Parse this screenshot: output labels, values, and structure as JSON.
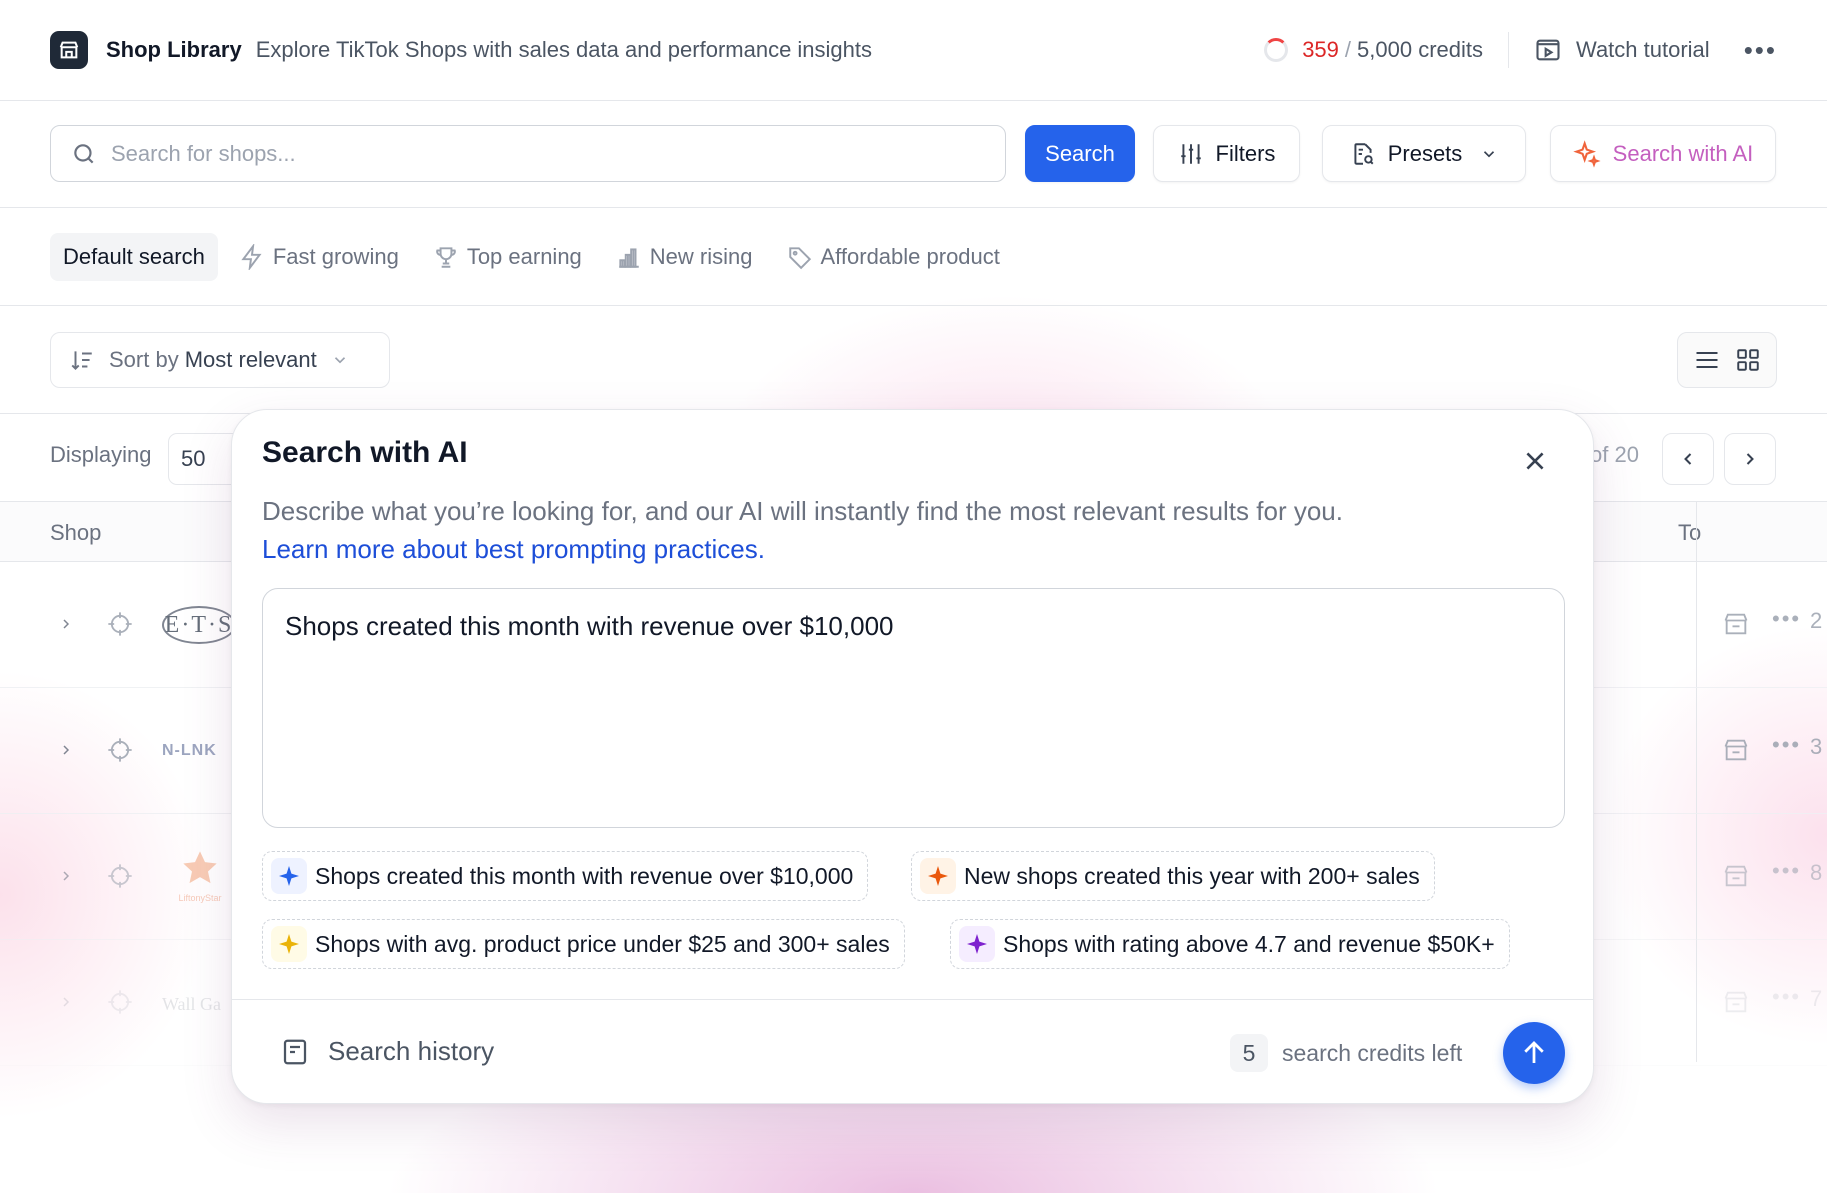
{
  "header": {
    "title": "Shop Library",
    "subtitle": "Explore TikTok Shops with sales data and performance insights",
    "credits_used": "359",
    "credits_total": "5,000 credits",
    "credits_sep": "/",
    "watch_tutorial": "Watch tutorial",
    "more": "•••"
  },
  "search": {
    "placeholder": "Search for shops...",
    "search_button": "Search",
    "filters_button": "Filters",
    "presets_button": "Presets",
    "ai_button": "Search with AI"
  },
  "tabs": [
    {
      "label": "Default search",
      "icon": "none",
      "active": true
    },
    {
      "label": "Fast growing",
      "icon": "lightning-icon"
    },
    {
      "label": "Top earning",
      "icon": "trophy-icon"
    },
    {
      "label": "New rising",
      "icon": "bar-chart-icon"
    },
    {
      "label": "Affordable product",
      "icon": "tag-icon"
    }
  ],
  "sort": {
    "prefix": "Sort by",
    "value": "Most relevant"
  },
  "display": {
    "label": "Displaying",
    "value": "50",
    "page_of": "of 20"
  },
  "table": {
    "col_shop": "Shop",
    "col_to": "To",
    "rows": [
      {
        "logo_text": "E·T·S",
        "trailing": "2"
      },
      {
        "logo_text": "N-LNK",
        "trailing": "3"
      },
      {
        "logo_text": "LiftonyStar",
        "trailing": "8"
      },
      {
        "logo_text": "Wall Ga",
        "trailing": "7"
      }
    ]
  },
  "modal": {
    "title": "Search with AI",
    "description": "Describe what you’re looking for, and our AI will instantly find the most relevant results for you.",
    "link": "Learn more about best prompting practices.",
    "prompt_value": "Shops created this month with revenue over $10,000",
    "suggestions": [
      {
        "label": "Shops created this month with revenue over $10,000",
        "color": "#2563eb",
        "bg": "#eef2ff"
      },
      {
        "label": "New shops created this year with 200+ sales",
        "color": "#ea580c",
        "bg": "#fff3e6"
      },
      {
        "label": "Shops with avg. product price under $25 and 300+ sales",
        "color": "#eab308",
        "bg": "#fffbe6"
      },
      {
        "label": "Shops with rating above 4.7 and revenue $50K+",
        "color": "#7e22ce",
        "bg": "#f5edff"
      }
    ],
    "history": "Search history",
    "credits_count": "5",
    "credits_text": "search credits left"
  },
  "colors": {
    "primary": "#2563eb",
    "credits_used": "#dc2626",
    "ai_accent": "#c45fbf"
  }
}
